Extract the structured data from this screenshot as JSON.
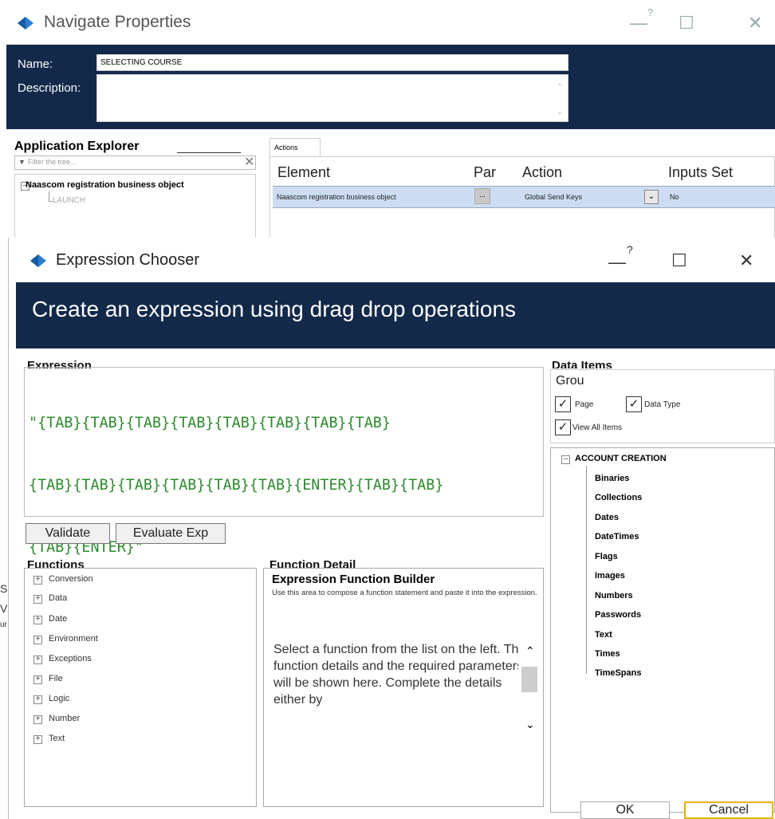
{
  "navigate_properties": {
    "title": "Navigate Properties",
    "window_controls": {
      "help": "?",
      "minimize": "—",
      "maximize": "☐",
      "close": "✕"
    },
    "name_label": "Name:",
    "name_value": "SELECTING COURSE",
    "description_label": "Description:",
    "description_value": "",
    "application_explorer": {
      "title": "Application Explorer",
      "filter_placeholder": "Filter the tree...",
      "root_node": "Naascom registration business object",
      "child_node": "LAUNCH"
    },
    "actions_tab": "Actions",
    "columns": [
      "Element",
      "Par",
      "Action",
      "Inputs Set"
    ],
    "row": {
      "element": "Naascom registration business object",
      "params_button": "...",
      "action": "Global Send Keys",
      "inputs_set": "No"
    },
    "left_edge_glyphs": [
      "S",
      "V",
      "ur"
    ]
  },
  "expression_chooser": {
    "title": "Expression Chooser",
    "window_controls": {
      "help": "?",
      "minimize": "—",
      "maximize": "☐",
      "close": "✕"
    },
    "banner": "Create an expression using drag drop operations",
    "expression_label": "Expression",
    "expression_lines": [
      "\"{TAB}{TAB}{TAB}{TAB}{TAB}{TAB}{TAB}{TAB}",
      "{TAB}{TAB}{TAB}{TAB}{TAB}{TAB}{ENTER}{TAB}{TAB}",
      "{TAB}{ENTER}\""
    ],
    "validate_button": "Validate",
    "evaluate_button": "Evaluate Exp",
    "functions_label": "Functions",
    "functions": [
      "Conversion",
      "Data",
      "Date",
      "Environment",
      "Exceptions",
      "File",
      "Logic",
      "Number",
      "Text"
    ],
    "function_detail_label": "Function Detail",
    "function_detail": {
      "heading": "Expression Function Builder",
      "subtext": "Use this area to compose a function statement and paste it into the expression.",
      "body": "Select a function from the list on the left. The function details and the required parameters will be shown here. Complete the details either by"
    },
    "data_items_label": "Data Items",
    "group_label": "Grou",
    "checkboxes": {
      "page": "Page",
      "data_type": "Data Type",
      "view_all": "View All Items"
    },
    "tree_root": "ACCOUNT CREATION",
    "tree_items": [
      "Binaries",
      "Collections",
      "Dates",
      "DateTimes",
      "Flags",
      "Images",
      "Numbers",
      "Passwords",
      "Text",
      "Times",
      "TimeSpans"
    ],
    "ok_button": "OK",
    "cancel_button": "Cancel"
  },
  "colors": {
    "header_navy": "#13294a",
    "expression_green": "#2e8b2e",
    "selected_row": "#cddcf2",
    "cancel_border": "#e8b400"
  }
}
